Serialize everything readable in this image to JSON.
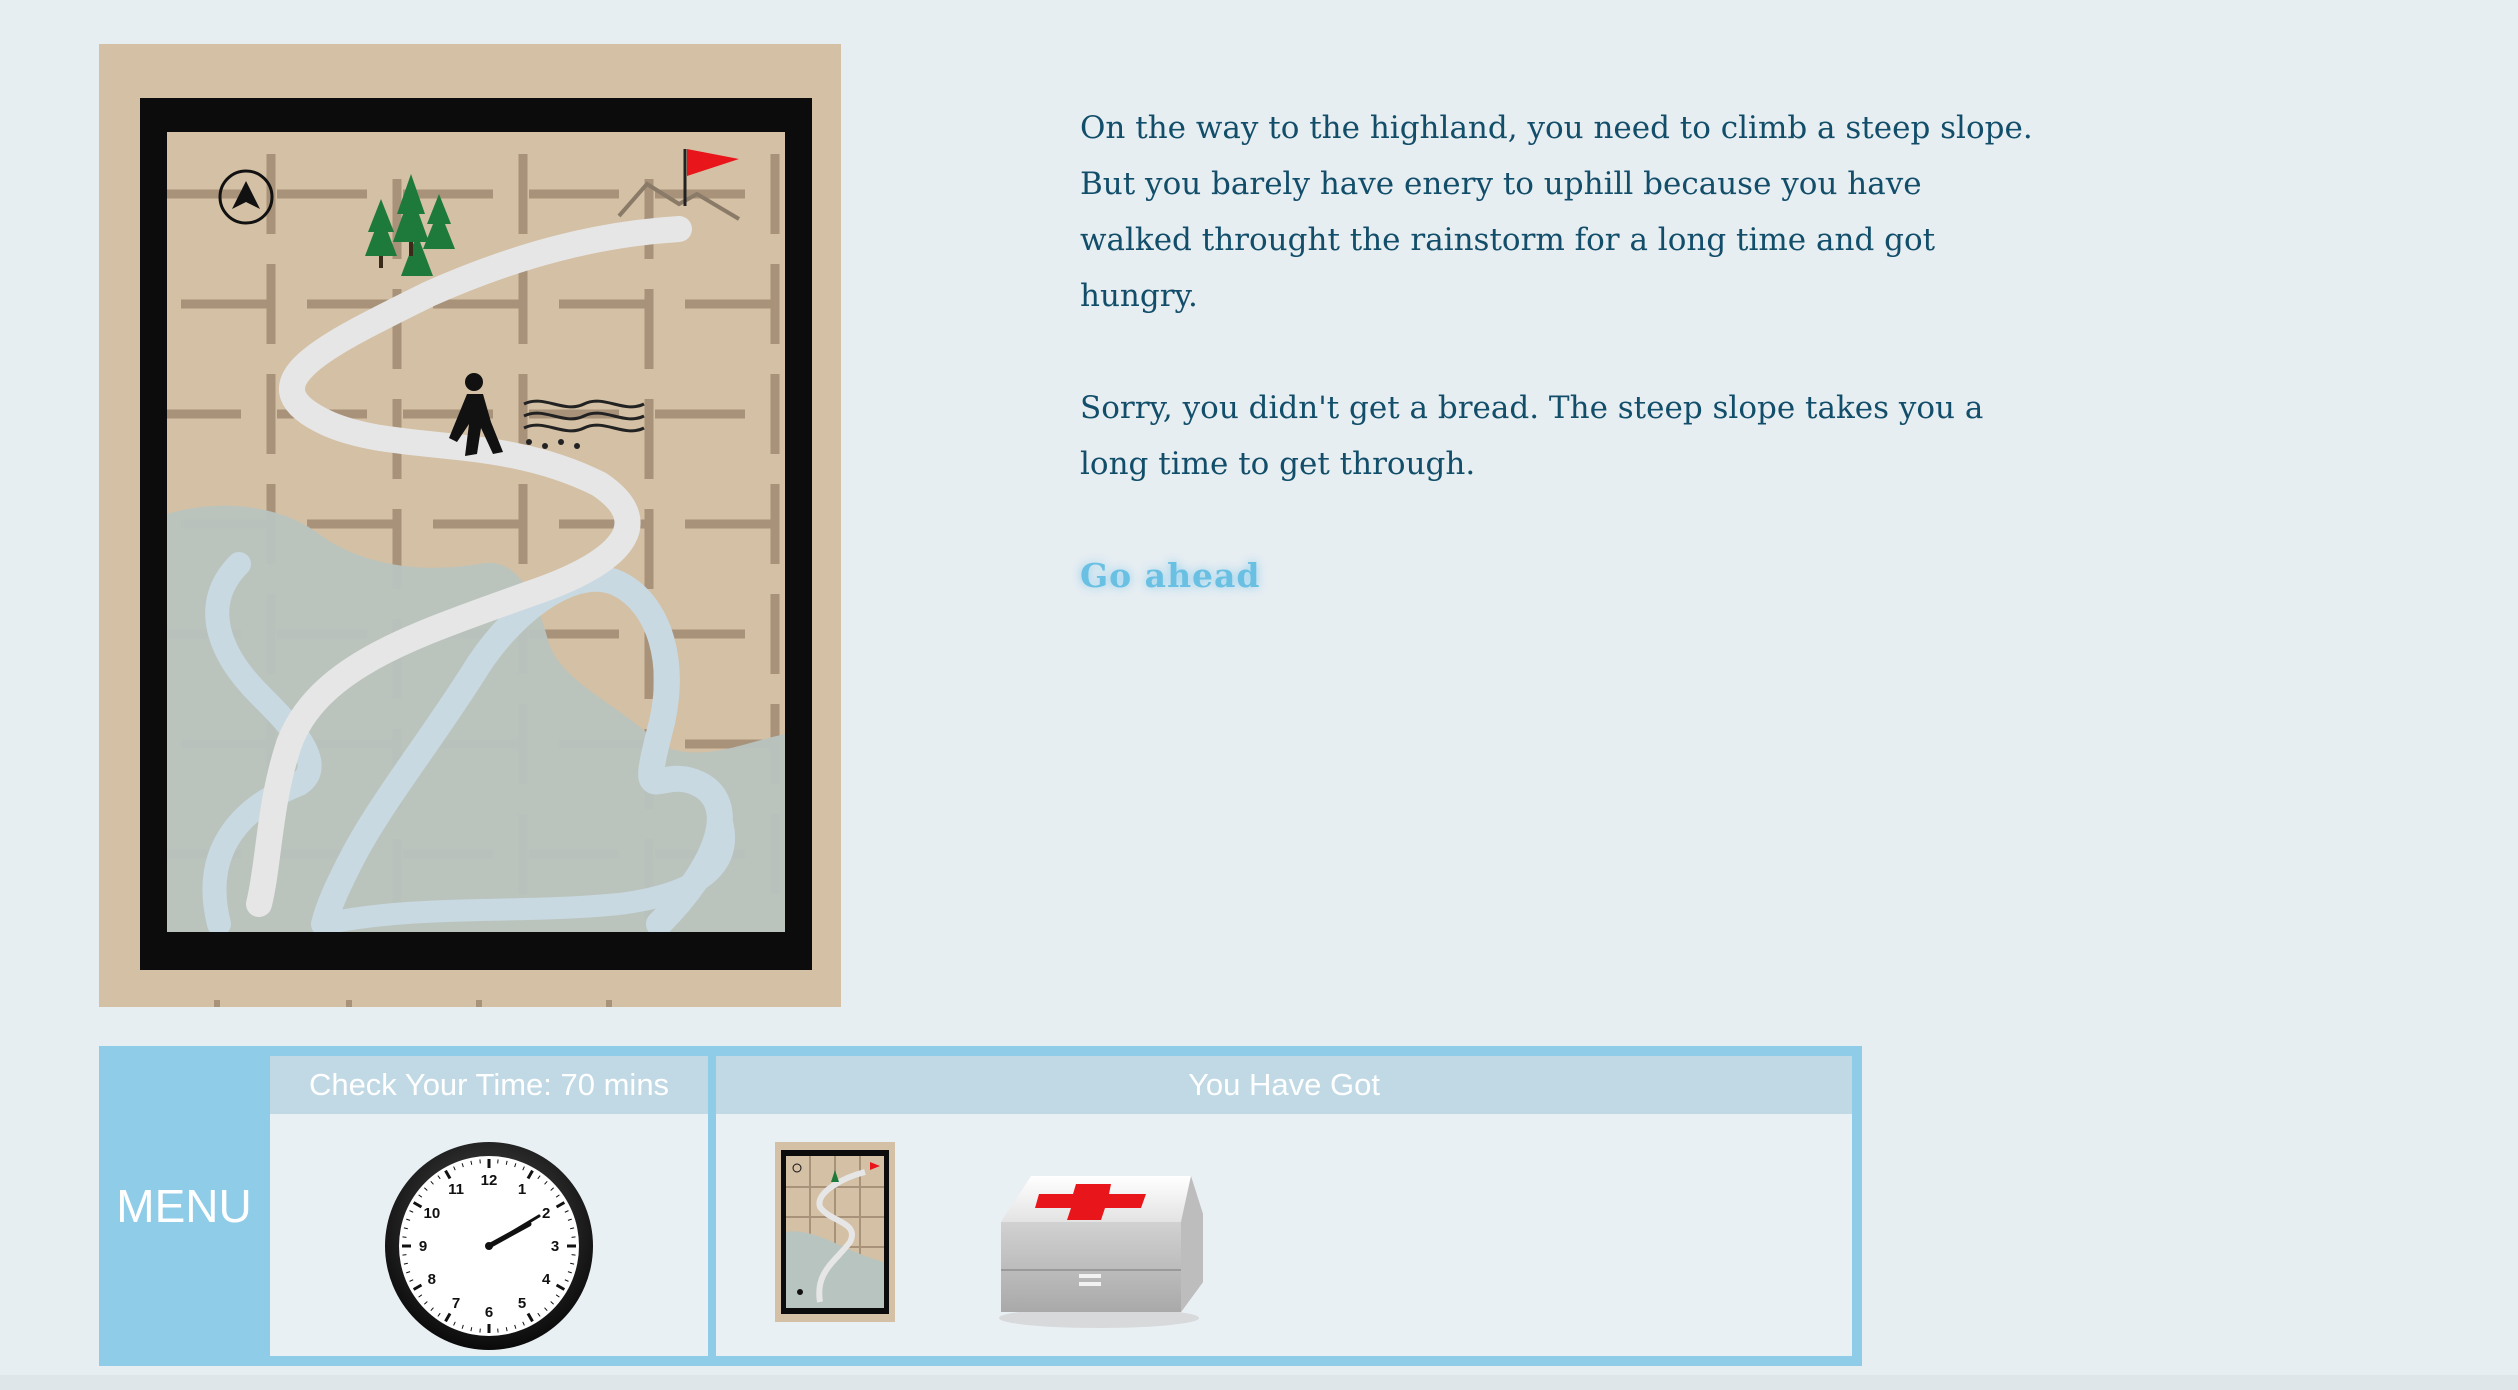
{
  "story": {
    "paragraph_1": "On the way to the highland, you need to climb a steep slope. But you barely have enery to uphill because you have walked throught the rainstorm for a long time and got hungry.",
    "paragraph_2": "Sorry, you didn't get a bread. The steep slope takes you a long time to get through.",
    "go_ahead_label": "Go ahead"
  },
  "menu": {
    "label": "MENU",
    "time_header": "Check Your Time: 70 mins",
    "items_header": "You Have Got"
  },
  "clock": {
    "numbers": [
      "12",
      "1",
      "2",
      "3",
      "4",
      "5",
      "6",
      "7",
      "8",
      "9",
      "10",
      "11"
    ]
  },
  "icons": {
    "map": "trail-map-icon",
    "first_aid": "first-aid-kit-icon",
    "compass": "north-arrow-icon",
    "flag": "red-flag-icon",
    "hiker": "hiker-icon"
  },
  "colors": {
    "page_bg": "#e7eef2",
    "text": "#124e6a",
    "link": "#6ac0e2",
    "menu_blue": "#8fcce8",
    "header_blue": "#c0d9e5",
    "map_tan": "#d4c0a4",
    "flag_red": "#e8151b",
    "cross_red": "#e8151b"
  }
}
